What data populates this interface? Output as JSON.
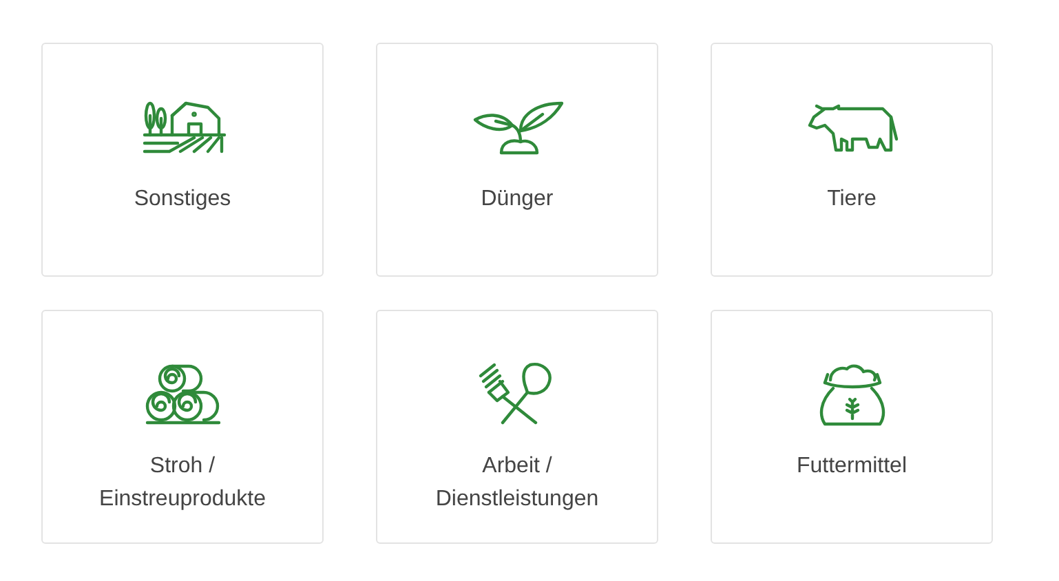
{
  "categories": [
    {
      "label": "Sonstiges",
      "kind": "farm"
    },
    {
      "label": "Dünger",
      "kind": "sprout"
    },
    {
      "label": "Tiere",
      "kind": "cow"
    },
    {
      "label": "Stroh /\nEinstreuprodukte",
      "kind": "bales"
    },
    {
      "label": "Arbeit /\nDienstleistungen",
      "kind": "tools"
    },
    {
      "label": "Futtermittel",
      "kind": "sack"
    }
  ]
}
